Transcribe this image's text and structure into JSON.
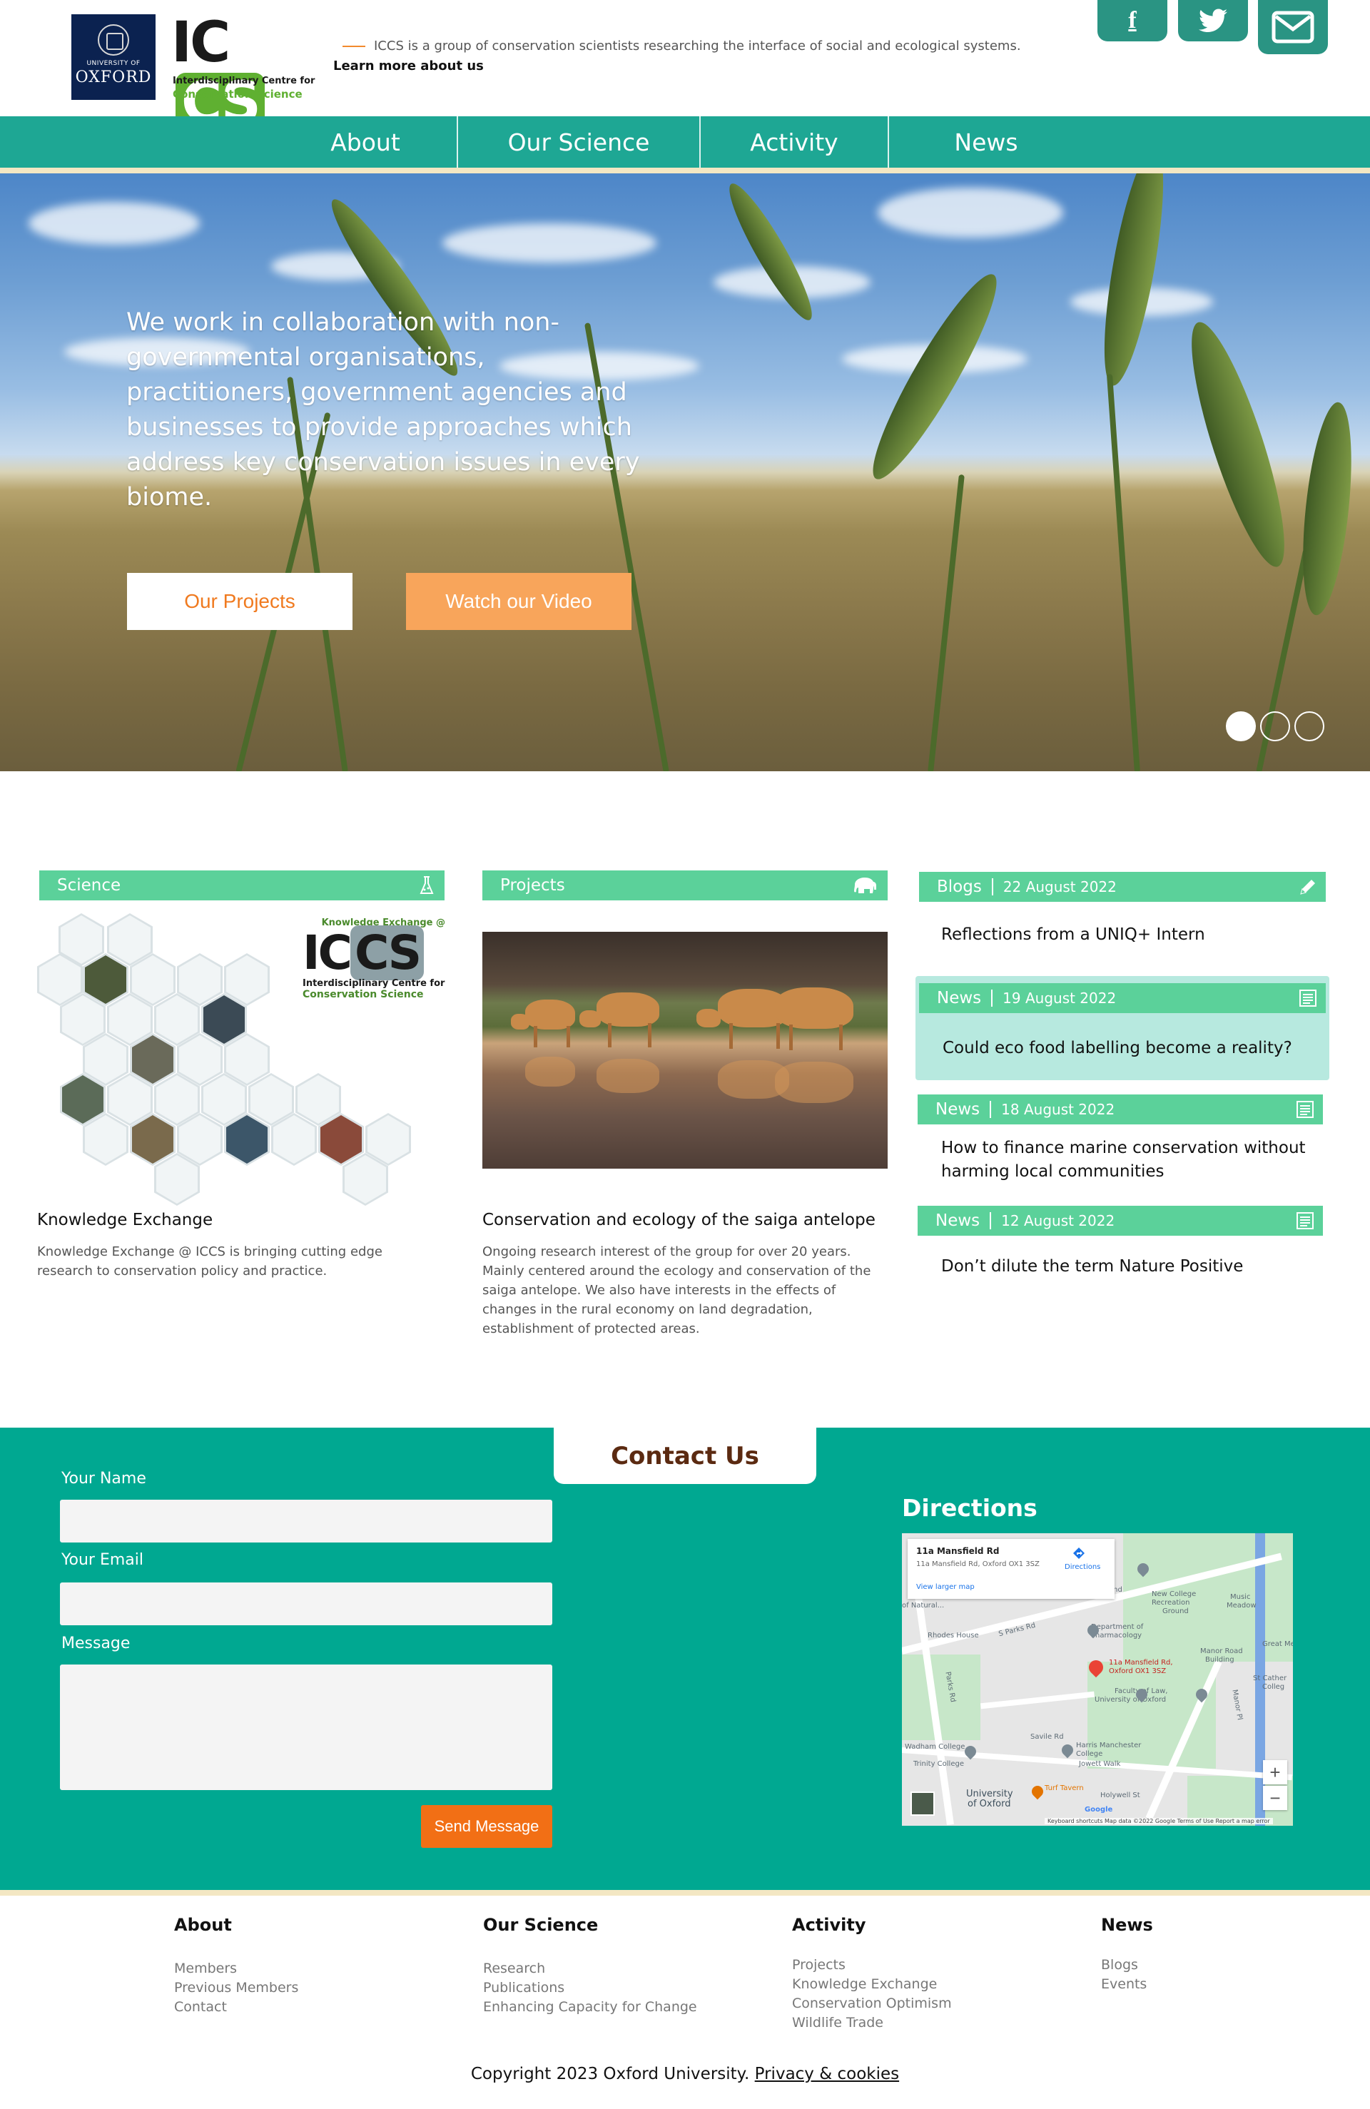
{
  "header": {
    "oxford_logo": {
      "university_of": "UNIVERSITY OF",
      "oxford": "OXFORD"
    },
    "iccs_logo": {
      "letters_ic": "IC",
      "letters_cs": "CS",
      "line1": "Interdisciplinary Centre for",
      "line2": "Conservation Science"
    },
    "tagline": "ICCS is a group of conservation scientists researching the interface of social and ecological systems.",
    "learn_more": "Learn more about us",
    "social": [
      {
        "icon": "facebook-icon",
        "glyph": "f"
      },
      {
        "icon": "twitter-icon"
      },
      {
        "icon": "email-icon"
      }
    ]
  },
  "nav": {
    "items": [
      "About",
      "Our Science",
      "Activity",
      "News"
    ]
  },
  "hero": {
    "text": "We work in collaboration with non-governmental organisations, practitioners, government agencies and businesses to provide approaches which address key conservation issues in every biome.",
    "primary_button": "Our Projects",
    "secondary_button": "Watch our Video",
    "slides": 3,
    "active_slide": 1
  },
  "cards": {
    "science": {
      "label": "Science",
      "icon": "flask-icon",
      "image_logo": {
        "top": "Knowledge Exchange @",
        "ic": "IC",
        "cs": "CS",
        "line1": "Interdisciplinary Centre for",
        "line2": "Conservation Science"
      },
      "title": "Knowledge Exchange",
      "description": "Knowledge Exchange @ ICCS is bringing cutting edge research to conservation policy and practice."
    },
    "projects": {
      "label": "Projects",
      "icon": "elephant-icon",
      "title": "Conservation and ecology of the saiga antelope",
      "description": "Ongoing research interest of the group for over 20 years. Mainly centered around the ecology and conservation of the saiga antelope. We also have interests in the effects of changes in the rural economy on land degradation, establishment of protected areas."
    },
    "news": [
      {
        "type": "Blogs",
        "date": "22 August 2022",
        "icon": "pencil-icon",
        "title": "Reflections from a UNIQ+ Intern",
        "highlighted": false
      },
      {
        "type": "News",
        "date": "19 August 2022",
        "icon": "newspaper-icon",
        "title": "Could eco food labelling become a reality?",
        "highlighted": true
      },
      {
        "type": "News",
        "date": "18 August 2022",
        "icon": "newspaper-icon",
        "title": "How to finance marine conservation without harming local communities",
        "highlighted": false
      },
      {
        "type": "News",
        "date": "12 August 2022",
        "icon": "newspaper-icon",
        "title": "Don’t dilute the term Nature Positive",
        "highlighted": false
      }
    ]
  },
  "contact": {
    "tab": "Contact Us",
    "name_label": "Your Name",
    "email_label": "Your Email",
    "message_label": "Message",
    "name_value": "",
    "email_value": "",
    "message_value": "",
    "send": "Send Message",
    "directions": "Directions",
    "map": {
      "card_title": "11a Mansfield Rd",
      "card_address": "11a Mansfield Rd, Oxford OX1 3SZ",
      "directions": "Directions",
      "view_larger": "View larger map",
      "marker_label_1": "11a Mansfield Rd,",
      "marker_label_2": "Oxford OX1 3SZ",
      "zoom_in": "+",
      "zoom_out": "−",
      "labels": {
        "rhodes_house": "Rhodes House",
        "s_parks_rd": "S Parks Rd",
        "parks_rd": "Parks Rd",
        "dept_pharmacology_1": "Department of",
        "dept_pharmacology_2": "Pharmacology",
        "new_college_1": "New College",
        "new_college_2": "Recreation",
        "new_college_3": "Ground",
        "music_meadow_1": "Music",
        "music_meadow_2": "Meadow",
        "manor_road_1": "Manor Road",
        "manor_road_2": "Building",
        "great_mea": "Great Mea",
        "st_cather_1": "St Cather",
        "st_cather_2": "Colleg",
        "faculty_law_1": "Faculty of Law,",
        "faculty_law_2": "University of Oxford",
        "manor_pl": "Manor Pl",
        "savile_rd": "Savile Rd",
        "harris_1": "Harris Manchester",
        "harris_2": "College",
        "jowett_walk": "Jowett Walk",
        "wadham": "Wadham College",
        "trinity": "Trinity College",
        "uni_oxford_1": "University",
        "uni_oxford_2": "of Oxford",
        "turf_tavern": "Turf Tavern",
        "holywell": "Holywell St",
        "natural": "of Natural...",
        "and": "and",
        "google": "Google",
        "footer": "Keyboard shortcuts   Map data ©2022 Google   Terms of Use   Report a map error"
      }
    }
  },
  "footer": {
    "columns": [
      {
        "heading": "About",
        "links": [
          "Members",
          "Previous Members",
          "Contact"
        ]
      },
      {
        "heading": "Our Science",
        "links": [
          "Research",
          "Publications",
          "Enhancing Capacity for Change"
        ]
      },
      {
        "heading": "Activity",
        "links": [
          "Projects",
          "Knowledge Exchange",
          "Conservation Optimism",
          "Wildlife Trade"
        ]
      },
      {
        "heading": "News",
        "links": [
          "Blogs",
          "Events"
        ]
      }
    ],
    "copyright": "Copyright 2023 Oxford University.",
    "privacy": "Privacy & cookies"
  },
  "colors": {
    "teal": "#1ea794",
    "contact_teal": "#00a891",
    "card_green": "#5bd19a",
    "accent_orange": "#f26f15",
    "stripe": "#f3e7c3",
    "news_highlight": "#b7e9df"
  }
}
